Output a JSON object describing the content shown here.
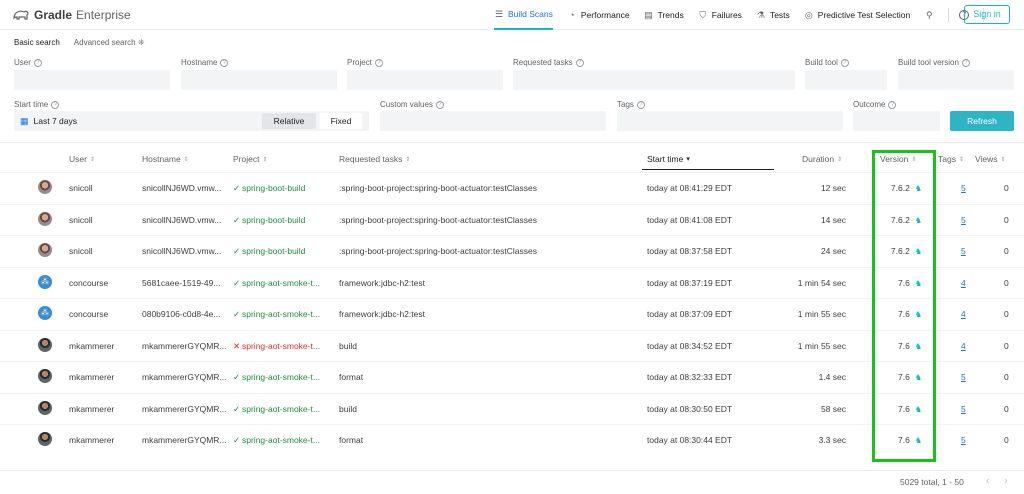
{
  "app": {
    "name_bold": "Gradle",
    "name_rest": "Enterprise"
  },
  "nav": {
    "items": [
      {
        "label": "Build Scans",
        "icon": "list-icon",
        "glyph": "☰"
      },
      {
        "label": "Performance",
        "icon": "gauge-icon",
        "glyph": "◔"
      },
      {
        "label": "Trends",
        "icon": "trends-icon",
        "glyph": "▤"
      },
      {
        "label": "Failures",
        "icon": "shield-icon",
        "glyph": "⛉"
      },
      {
        "label": "Tests",
        "icon": "tests-icon",
        "glyph": "⚗"
      },
      {
        "label": "Predictive Test Selection",
        "icon": "predictive-icon",
        "glyph": "◎"
      }
    ],
    "search_glyph": "⚲",
    "help_glyph": "?",
    "signin": "Sign in"
  },
  "search": {
    "tab_basic": "Basic search",
    "tab_advanced": "Advanced search ⁜",
    "labels": {
      "user": "User",
      "hostname": "Hostname",
      "project": "Project",
      "requested_tasks": "Requested tasks",
      "build_tool": "Build tool",
      "build_tool_version": "Build tool version",
      "start_time": "Start time",
      "custom_values": "Custom values",
      "tags": "Tags",
      "outcome": "Outcome"
    },
    "start_time_value": "Last 7 days",
    "relative": "Relative",
    "fixed": "Fixed",
    "refresh": "Refresh"
  },
  "table": {
    "headers": {
      "user": "User",
      "hostname": "Hostname",
      "project": "Project",
      "requested_tasks": "Requested tasks",
      "start_time": "Start time",
      "duration": "Duration",
      "version": "Version",
      "tags": "Tags",
      "views": "Views"
    },
    "rows": [
      {
        "avatar": "person",
        "user": "snicoll",
        "hostname": "snicollNJ6WD.vmw...",
        "status": "success",
        "project": "spring-boot-build",
        "tasks": ":spring-boot-project:spring-boot-actuator:testClasses",
        "start": "today at 08:41:29 EDT",
        "duration": "12 sec",
        "version": "7.6.2",
        "tags": "5",
        "views": "0"
      },
      {
        "avatar": "person",
        "user": "snicoll",
        "hostname": "snicollNJ6WD.vmw...",
        "status": "success",
        "project": "spring-boot-build",
        "tasks": ":spring-boot-project:spring-boot-actuator:testClasses",
        "start": "today at 08:41:08 EDT",
        "duration": "14 sec",
        "version": "7.6.2",
        "tags": "5",
        "views": "0"
      },
      {
        "avatar": "person",
        "user": "snicoll",
        "hostname": "snicollNJ6WD.vmw...",
        "status": "success",
        "project": "spring-boot-build",
        "tasks": ":spring-boot-project:spring-boot-actuator:testClasses",
        "start": "today at 08:37:58 EDT",
        "duration": "24 sec",
        "version": "7.6.2",
        "tags": "5",
        "views": "0"
      },
      {
        "avatar": "bot",
        "user": "concourse",
        "hostname": "5681caee-1519-49...",
        "status": "success",
        "project": "spring-aot-smoke-t...",
        "tasks": "framework:jdbc-h2:test",
        "start": "today at 08:37:19 EDT",
        "duration": "1 min 54 sec",
        "version": "7.6",
        "tags": "4",
        "views": "0"
      },
      {
        "avatar": "bot",
        "user": "concourse",
        "hostname": "080b9106-c0d8-4e...",
        "status": "success",
        "project": "spring-aot-smoke-t...",
        "tasks": "framework:jdbc-h2:test",
        "start": "today at 08:37:09 EDT",
        "duration": "1 min 55 sec",
        "version": "7.6",
        "tags": "4",
        "views": "0"
      },
      {
        "avatar": "mk",
        "user": "mkammerer",
        "hostname": "mkammererGYQMR...",
        "status": "failed",
        "project": "spring-aot-smoke-t...",
        "tasks": "build",
        "start": "today at 08:34:52 EDT",
        "duration": "1 min 55 sec",
        "version": "7.6",
        "tags": "4",
        "views": "0"
      },
      {
        "avatar": "mk",
        "user": "mkammerer",
        "hostname": "mkammererGYQMR...",
        "status": "success",
        "project": "spring-aot-smoke-t...",
        "tasks": "format",
        "start": "today at 08:32:33 EDT",
        "duration": "1.4 sec",
        "version": "7.6",
        "tags": "5",
        "views": "0"
      },
      {
        "avatar": "mk",
        "user": "mkammerer",
        "hostname": "mkammererGYQMR...",
        "status": "success",
        "project": "spring-aot-smoke-t...",
        "tasks": "build",
        "start": "today at 08:30:50 EDT",
        "duration": "58 sec",
        "version": "7.6",
        "tags": "5",
        "views": "0"
      },
      {
        "avatar": "mk",
        "user": "mkammerer",
        "hostname": "mkammererGYQMR...",
        "status": "success",
        "project": "spring-aot-smoke-t...",
        "tasks": "format",
        "start": "today at 08:30:44 EDT",
        "duration": "3.3 sec",
        "version": "7.6",
        "tags": "5",
        "views": "0"
      }
    ]
  },
  "footer": {
    "total": "5029 total, 1 - 50",
    "prev": "‹",
    "next": "›"
  },
  "colors": {
    "accent": "#1ab6bd",
    "success": "#1e8e3e",
    "failure": "#d93025",
    "highlight": "#19c219",
    "link": "#1a73e8"
  }
}
